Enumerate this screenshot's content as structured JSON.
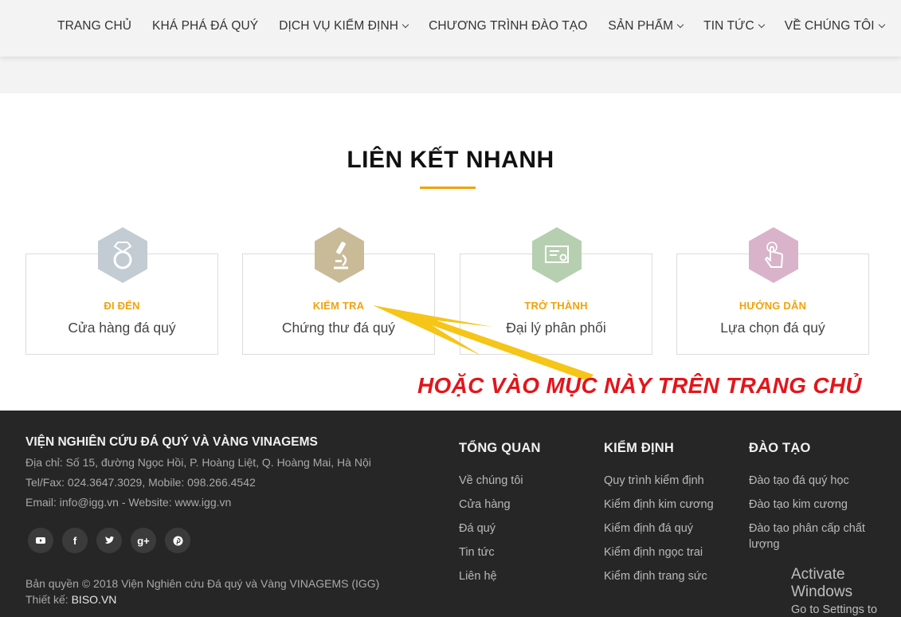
{
  "nav": {
    "items": [
      {
        "label": "TRANG CHỦ",
        "dropdown": false
      },
      {
        "label": "KHÁ PHÁ ĐÁ QUÝ",
        "dropdown": false
      },
      {
        "label": "DỊCH VỤ KIỂM ĐỊNH",
        "dropdown": true
      },
      {
        "label": "CHƯƠNG TRÌNH ĐÀO TẠO",
        "dropdown": false
      },
      {
        "label": "SẢN PHẨM",
        "dropdown": true
      },
      {
        "label": "TIN TỨC",
        "dropdown": true
      },
      {
        "label": "VỀ CHÚNG TÔI",
        "dropdown": true
      }
    ]
  },
  "section": {
    "title": "LIÊN KẾT NHANH",
    "accent": "#f2a20a"
  },
  "cards": [
    {
      "kicker": "ĐI ĐẾN",
      "sub": "Cửa hàng đá quý",
      "icon": "ring-icon",
      "hex_color": "#c3ccd3"
    },
    {
      "kicker": "KIỂM TRA",
      "sub": "Chứng thư đá quý",
      "icon": "microscope-icon",
      "hex_color": "#c9bb98"
    },
    {
      "kicker": "TRỞ THÀNH",
      "sub": "Đại lý phân phối",
      "icon": "certificate-icon",
      "hex_color": "#b6cfb0"
    },
    {
      "kicker": "HƯỚNG DẪN",
      "sub": "Lựa chọn đá quý",
      "icon": "hand-pointer-icon",
      "hex_color": "#d9b3c9"
    }
  ],
  "annotation": {
    "text": "HOẶC VÀO MỤC NÀY TRÊN TRANG CHỦ",
    "color": "#e3151b",
    "arrow_color": "#f5c518"
  },
  "footer": {
    "org": "VIỆN NGHIÊN CỨU ĐÁ QUÝ VÀ VÀNG VINAGEMS",
    "address": "Địa chỉ: Số 15, đường Ngọc Hồi, P. Hoàng Liệt, Q. Hoàng Mai, Hà Nội",
    "phone": "Tel/Fax: 024.3647.3029, Mobile: 098.266.4542",
    "email": "Email: info@igg.vn - Website: www.igg.vn",
    "social": [
      "youtube-icon",
      "facebook-icon",
      "twitter-icon",
      "google-plus-icon",
      "pinterest-icon"
    ],
    "copyright": "Bản quyền © 2018 Viện Nghiên cứu Đá quý và Vàng VINAGEMS (IGG)",
    "design_label": "Thiết kế: ",
    "design_link": "BISO.VN",
    "columns": [
      {
        "title": "TỔNG QUAN",
        "links": [
          "Về chúng tôi",
          "Cửa hàng",
          "Đá quý",
          "Tin tức",
          "Liên hệ"
        ]
      },
      {
        "title": "KIỂM ĐỊNH",
        "links": [
          "Quy trình kiểm định",
          "Kiểm định kim cương",
          "Kiểm định đá quý",
          "Kiểm định ngọc trai",
          "Kiểm định trang sức"
        ]
      },
      {
        "title": "ĐÀO TẠO",
        "links": [
          "Đào tạo đá quý học",
          "Đào tạo kim cương",
          "Đào tạo phân cấp chất lượng"
        ]
      }
    ]
  },
  "windows": {
    "line1": "Activate Windows",
    "line2": "Go to Settings to activate Windows."
  }
}
